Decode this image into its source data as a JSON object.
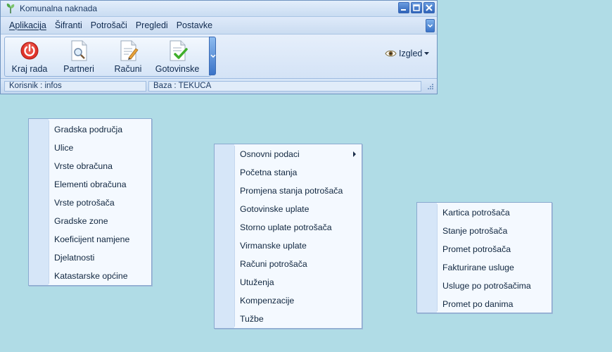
{
  "window": {
    "title": "Komunalna naknada",
    "menu": [
      "Aplikacija",
      "Šifranti",
      "Potrošači",
      "Pregledi",
      "Postavke"
    ],
    "toolbar": [
      {
        "label": "Kraj rada",
        "icon": "power-icon"
      },
      {
        "label": "Partneri",
        "icon": "document-search-icon"
      },
      {
        "label": "Računi",
        "icon": "document-edit-icon"
      },
      {
        "label": "Gotovinske",
        "icon": "document-check-icon"
      }
    ],
    "view_menu_label": "Izgled",
    "status": {
      "user": "Korisnik  :  infos",
      "database": "Baza  :  TEKUCA"
    }
  },
  "menus": {
    "sifranti": [
      "Gradska područja",
      "Ulice",
      "Vrste obračuna",
      "Elementi obračuna",
      "Vrste potrošača",
      "Gradske zone",
      "Koeficijent namjene",
      "Djelatnosti",
      "Katastarske općine"
    ],
    "potrosaci": [
      "Osnovni podaci",
      "Početna stanja",
      "Promjena stanja potrošača",
      "Gotovinske uplate",
      "Storno uplate potrošača",
      "Virmanske uplate",
      "Računi potrošača",
      "Utuženja",
      "Kompenzacije",
      "Tužbe"
    ],
    "pregledi": [
      "Kartica potrošača",
      "Stanje potrošača",
      "Promet potrošača",
      "Fakturirane usluge",
      "Usluge po potrošačima",
      "Promet po danima"
    ]
  },
  "colors": {
    "desktop": "#b0dce6",
    "menu_background": "#f4f9ff",
    "accent_blue": "#3a73c8"
  }
}
